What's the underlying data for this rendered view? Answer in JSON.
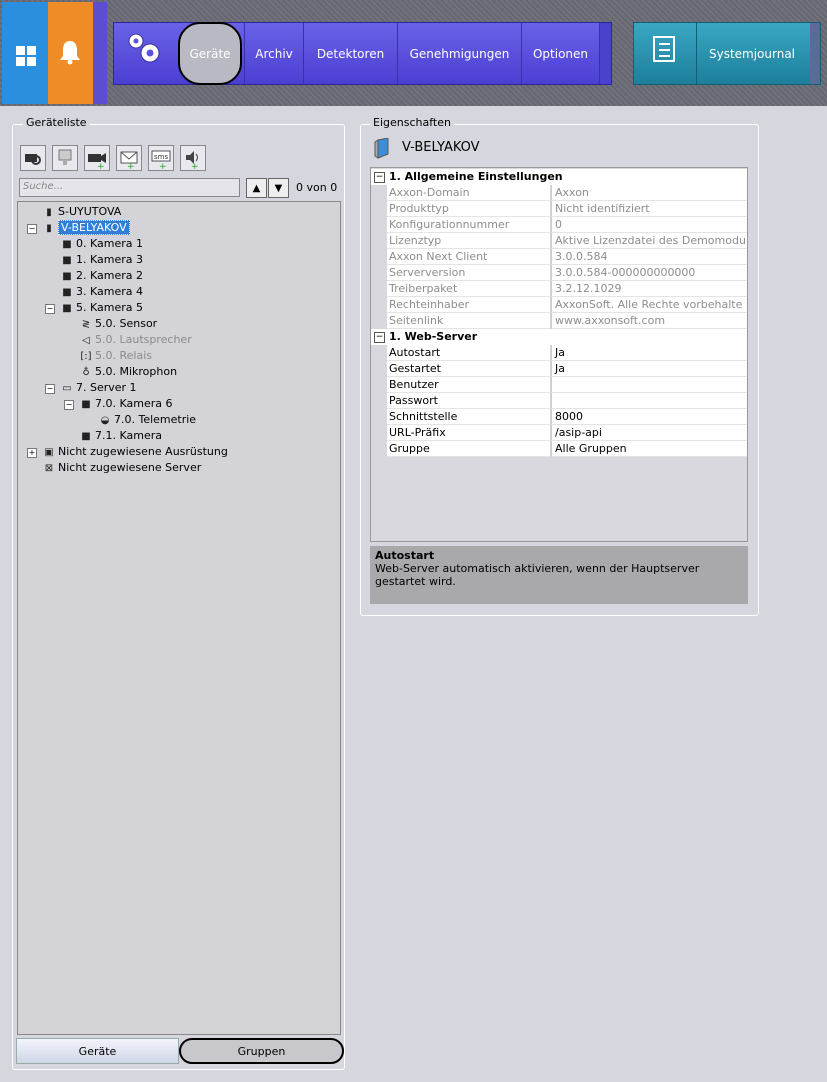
{
  "topbar": {
    "nav": [
      "Geräte",
      "Archiv",
      "Detektoren",
      "Genehmigungen",
      "Optionen"
    ],
    "active": "Geräte",
    "journal_label": "Systemjournal",
    "colors": {
      "win_tile": "#2b8fe0",
      "bell_tile": "#f08c25",
      "nav": "#5a52de",
      "journal": "#2a93b0"
    }
  },
  "device_list": {
    "legend": "Geräteliste",
    "search_placeholder": "Suche...",
    "count": "0 von 0",
    "tree": [
      {
        "label": "S-UYUTOVA",
        "icon": "server-icon"
      },
      {
        "label": "V-BELYAKOV",
        "icon": "server-icon",
        "selected": true
      },
      {
        "label": "0. Kamera 1",
        "icon": "camera-icon"
      },
      {
        "label": "1. Kamera 3",
        "icon": "camera-icon"
      },
      {
        "label": "2. Kamera 2",
        "icon": "camera-icon"
      },
      {
        "label": "3. Kamera 4",
        "icon": "camera-icon"
      },
      {
        "label": "5. Kamera 5",
        "icon": "camera-icon"
      },
      {
        "label": "5.0. Sensor",
        "icon": "sensor-icon"
      },
      {
        "label": "5.0. Lautsprecher",
        "icon": "speaker-icon",
        "disabled": true
      },
      {
        "label": "5.0. Relais",
        "icon": "relay-icon",
        "disabled": true
      },
      {
        "label": "5.0. Mikrophon",
        "icon": "microphone-icon"
      },
      {
        "label": "7. Server 1",
        "icon": "rack-server-icon"
      },
      {
        "label": "7.0. Kamera 6",
        "icon": "camera-icon"
      },
      {
        "label": "7.0. Telemetrie",
        "icon": "telemetry-icon"
      },
      {
        "label": "7.1. Kamera",
        "icon": "camera-icon"
      },
      {
        "label": "Nicht zugewiesene Ausrüstung",
        "icon": "equipment-icon"
      },
      {
        "label": "Nicht zugewiesene Server",
        "icon": "unassigned-server-icon"
      }
    ],
    "tabs": [
      "Geräte",
      "Gruppen"
    ]
  },
  "properties": {
    "legend": "Eigenschaften",
    "title": "V-BELYAKOV",
    "categories": [
      {
        "label": "1. Allgemeine Einstellungen",
        "rows": [
          {
            "key": "Axxon-Domain",
            "value": "Axxon"
          },
          {
            "key": "Produkttyp",
            "value": "Nicht identifiziert"
          },
          {
            "key": "Konfigurationnummer",
            "value": "0"
          },
          {
            "key": "Lizenztyp",
            "value": "Aktive Lizenzdatei des Demomodu"
          },
          {
            "key": "Axxon Next Client",
            "value": "3.0.0.584"
          },
          {
            "key": "Serverversion",
            "value": "3.0.0.584-000000000000"
          },
          {
            "key": "Treiberpaket",
            "value": "3.2.12.1029"
          },
          {
            "key": "Rechteinhaber",
            "value": "AxxonSoft. Alle Rechte vorbehalte"
          },
          {
            "key": "Seitenlink",
            "value": "www.axxonsoft.com"
          }
        ]
      },
      {
        "label": "1. Web-Server",
        "rows": [
          {
            "key": "Autostart",
            "value": "Ja"
          },
          {
            "key": "Gestartet",
            "value": "Ja"
          },
          {
            "key": "Benutzer",
            "value": ""
          },
          {
            "key": "Passwort",
            "value": ""
          },
          {
            "key": "Schnittstelle",
            "value": "8000"
          },
          {
            "key": "URL-Präfix",
            "value": "/asip-api"
          },
          {
            "key": "Gruppe",
            "value": "Alle Gruppen"
          }
        ]
      }
    ],
    "description": {
      "title": "Autostart",
      "text_line1": "Web-Server automatisch aktivieren, wenn der Hauptserver",
      "text_line2": "gestartet wird."
    }
  }
}
